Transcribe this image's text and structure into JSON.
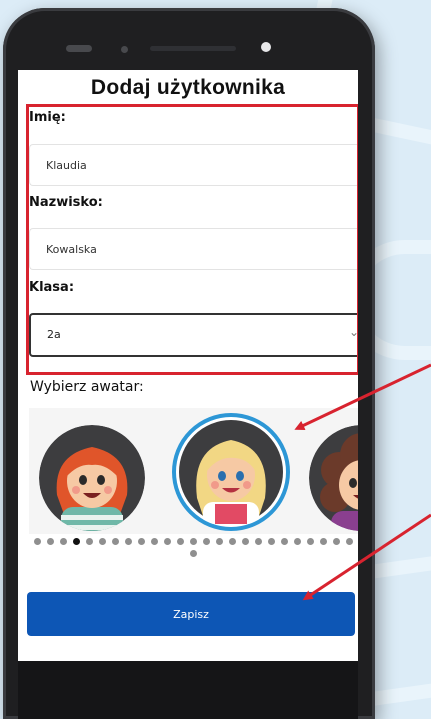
{
  "form": {
    "title": "Dodaj użytkownika",
    "first_name": {
      "label": "Imię:",
      "value": "Klaudia"
    },
    "last_name": {
      "label": "Nazwisko:",
      "value": "Kowalska"
    },
    "class": {
      "label": "Klasa:",
      "value": "2a"
    },
    "avatar_label": "Wybierz awatar:",
    "avatars": [
      {
        "icon": "red-hair-girl-avatar",
        "selected": false
      },
      {
        "icon": "blonde-girl-avatar",
        "selected": true
      },
      {
        "icon": "curly-hair-girl-avatar",
        "selected": false
      }
    ],
    "carousel_pages": 26,
    "carousel_active_page": 4,
    "save_label": "Zapisz"
  },
  "colors": {
    "accent": "#0d56b5",
    "highlight": "#d8232f",
    "selected_ring": "#2d97d6"
  }
}
